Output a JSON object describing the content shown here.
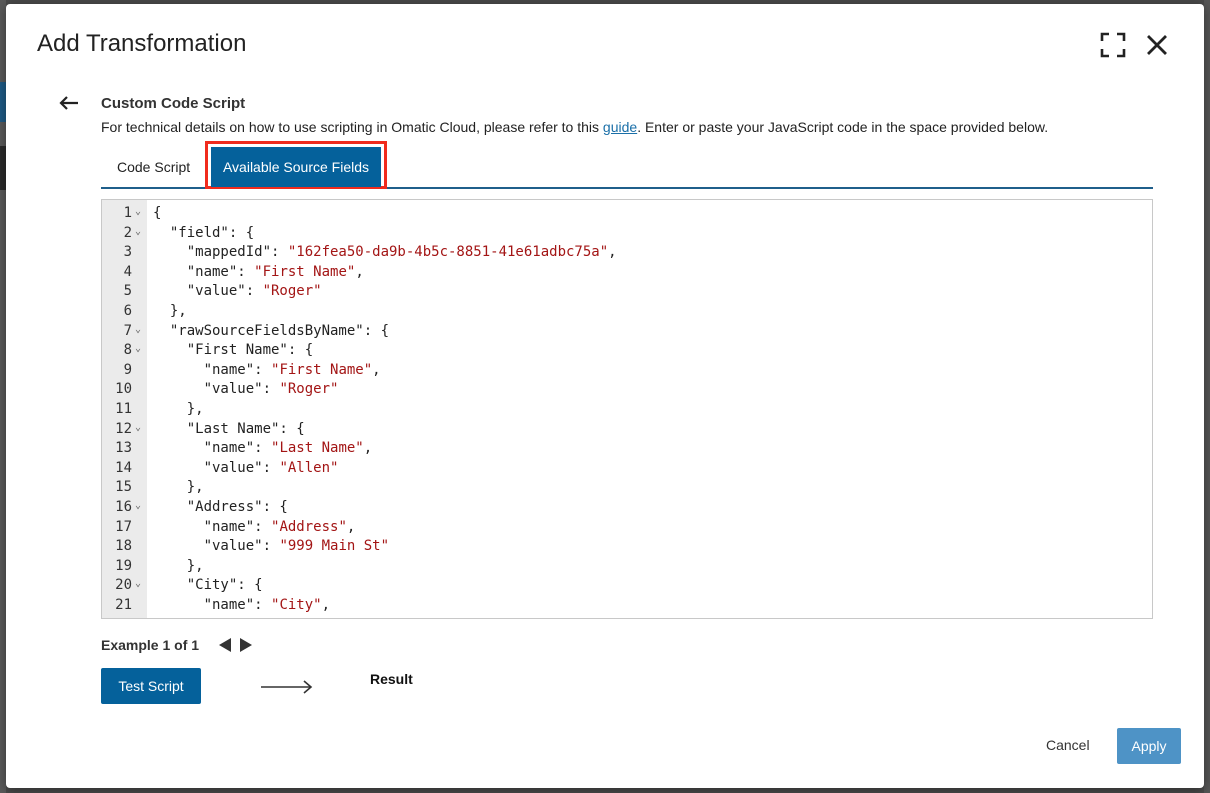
{
  "modal": {
    "title": "Add Transformation",
    "expand_icon": "expand-icon",
    "close_icon": "close-icon"
  },
  "section": {
    "back_icon": "arrow-left-icon",
    "title": "Custom Code Script",
    "desc_before": "For technical details on how to use scripting in Omatic Cloud, please refer to this ",
    "desc_link": "guide",
    "desc_after": ". Enter or paste your JavaScript code in the space provided below."
  },
  "tabs": [
    {
      "label": "Code Script",
      "active": false
    },
    {
      "label": "Available Source Fields",
      "active": true
    }
  ],
  "editor": {
    "lines": [
      {
        "n": "1",
        "fold": true,
        "parts": [
          [
            "p",
            "{"
          ]
        ]
      },
      {
        "n": "2",
        "fold": true,
        "parts": [
          [
            "p",
            "  \"field\": {"
          ]
        ]
      },
      {
        "n": "3",
        "fold": false,
        "parts": [
          [
            "p",
            "    \"mappedId\": "
          ],
          [
            "s",
            "\"162fea50-da9b-4b5c-8851-41e61adbc75a\""
          ],
          [
            "p",
            ","
          ]
        ]
      },
      {
        "n": "4",
        "fold": false,
        "parts": [
          [
            "p",
            "    \"name\": "
          ],
          [
            "s",
            "\"First Name\""
          ],
          [
            "p",
            ","
          ]
        ]
      },
      {
        "n": "5",
        "fold": false,
        "parts": [
          [
            "p",
            "    \"value\": "
          ],
          [
            "s",
            "\"Roger\""
          ]
        ]
      },
      {
        "n": "6",
        "fold": false,
        "parts": [
          [
            "p",
            "  },"
          ]
        ]
      },
      {
        "n": "7",
        "fold": true,
        "parts": [
          [
            "p",
            "  \"rawSourceFieldsByName\": {"
          ]
        ]
      },
      {
        "n": "8",
        "fold": true,
        "parts": [
          [
            "p",
            "    \"First Name\": {"
          ]
        ]
      },
      {
        "n": "9",
        "fold": false,
        "parts": [
          [
            "p",
            "      \"name\": "
          ],
          [
            "s",
            "\"First Name\""
          ],
          [
            "p",
            ","
          ]
        ]
      },
      {
        "n": "10",
        "fold": false,
        "parts": [
          [
            "p",
            "      \"value\": "
          ],
          [
            "s",
            "\"Roger\""
          ]
        ]
      },
      {
        "n": "11",
        "fold": false,
        "parts": [
          [
            "p",
            "    },"
          ]
        ]
      },
      {
        "n": "12",
        "fold": true,
        "parts": [
          [
            "p",
            "    \"Last Name\": {"
          ]
        ]
      },
      {
        "n": "13",
        "fold": false,
        "parts": [
          [
            "p",
            "      \"name\": "
          ],
          [
            "s",
            "\"Last Name\""
          ],
          [
            "p",
            ","
          ]
        ]
      },
      {
        "n": "14",
        "fold": false,
        "parts": [
          [
            "p",
            "      \"value\": "
          ],
          [
            "s",
            "\"Allen\""
          ]
        ]
      },
      {
        "n": "15",
        "fold": false,
        "parts": [
          [
            "p",
            "    },"
          ]
        ]
      },
      {
        "n": "16",
        "fold": true,
        "parts": [
          [
            "p",
            "    \"Address\": {"
          ]
        ]
      },
      {
        "n": "17",
        "fold": false,
        "parts": [
          [
            "p",
            "      \"name\": "
          ],
          [
            "s",
            "\"Address\""
          ],
          [
            "p",
            ","
          ]
        ]
      },
      {
        "n": "18",
        "fold": false,
        "parts": [
          [
            "p",
            "      \"value\": "
          ],
          [
            "s",
            "\"999 Main St\""
          ]
        ]
      },
      {
        "n": "19",
        "fold": false,
        "parts": [
          [
            "p",
            "    },"
          ]
        ]
      },
      {
        "n": "20",
        "fold": true,
        "parts": [
          [
            "p",
            "    \"City\": {"
          ]
        ]
      },
      {
        "n": "21",
        "fold": false,
        "parts": [
          [
            "p",
            "      \"name\": "
          ],
          [
            "s",
            "\"City\""
          ],
          [
            "p",
            ","
          ]
        ]
      }
    ]
  },
  "example": {
    "label": "Example 1 of 1",
    "prev_icon": "triangle-left-icon",
    "next_icon": "triangle-right-icon"
  },
  "test": {
    "button_label": "Test Script",
    "arrow_icon": "long-arrow-right-icon",
    "result_label": "Result"
  },
  "footer": {
    "cancel_label": "Cancel",
    "apply_label": "Apply"
  },
  "colors": {
    "primary": "#05619b",
    "apply_disabled": "#4e93c6",
    "highlight_outline": "#f02b1d",
    "string": "#a31515"
  }
}
